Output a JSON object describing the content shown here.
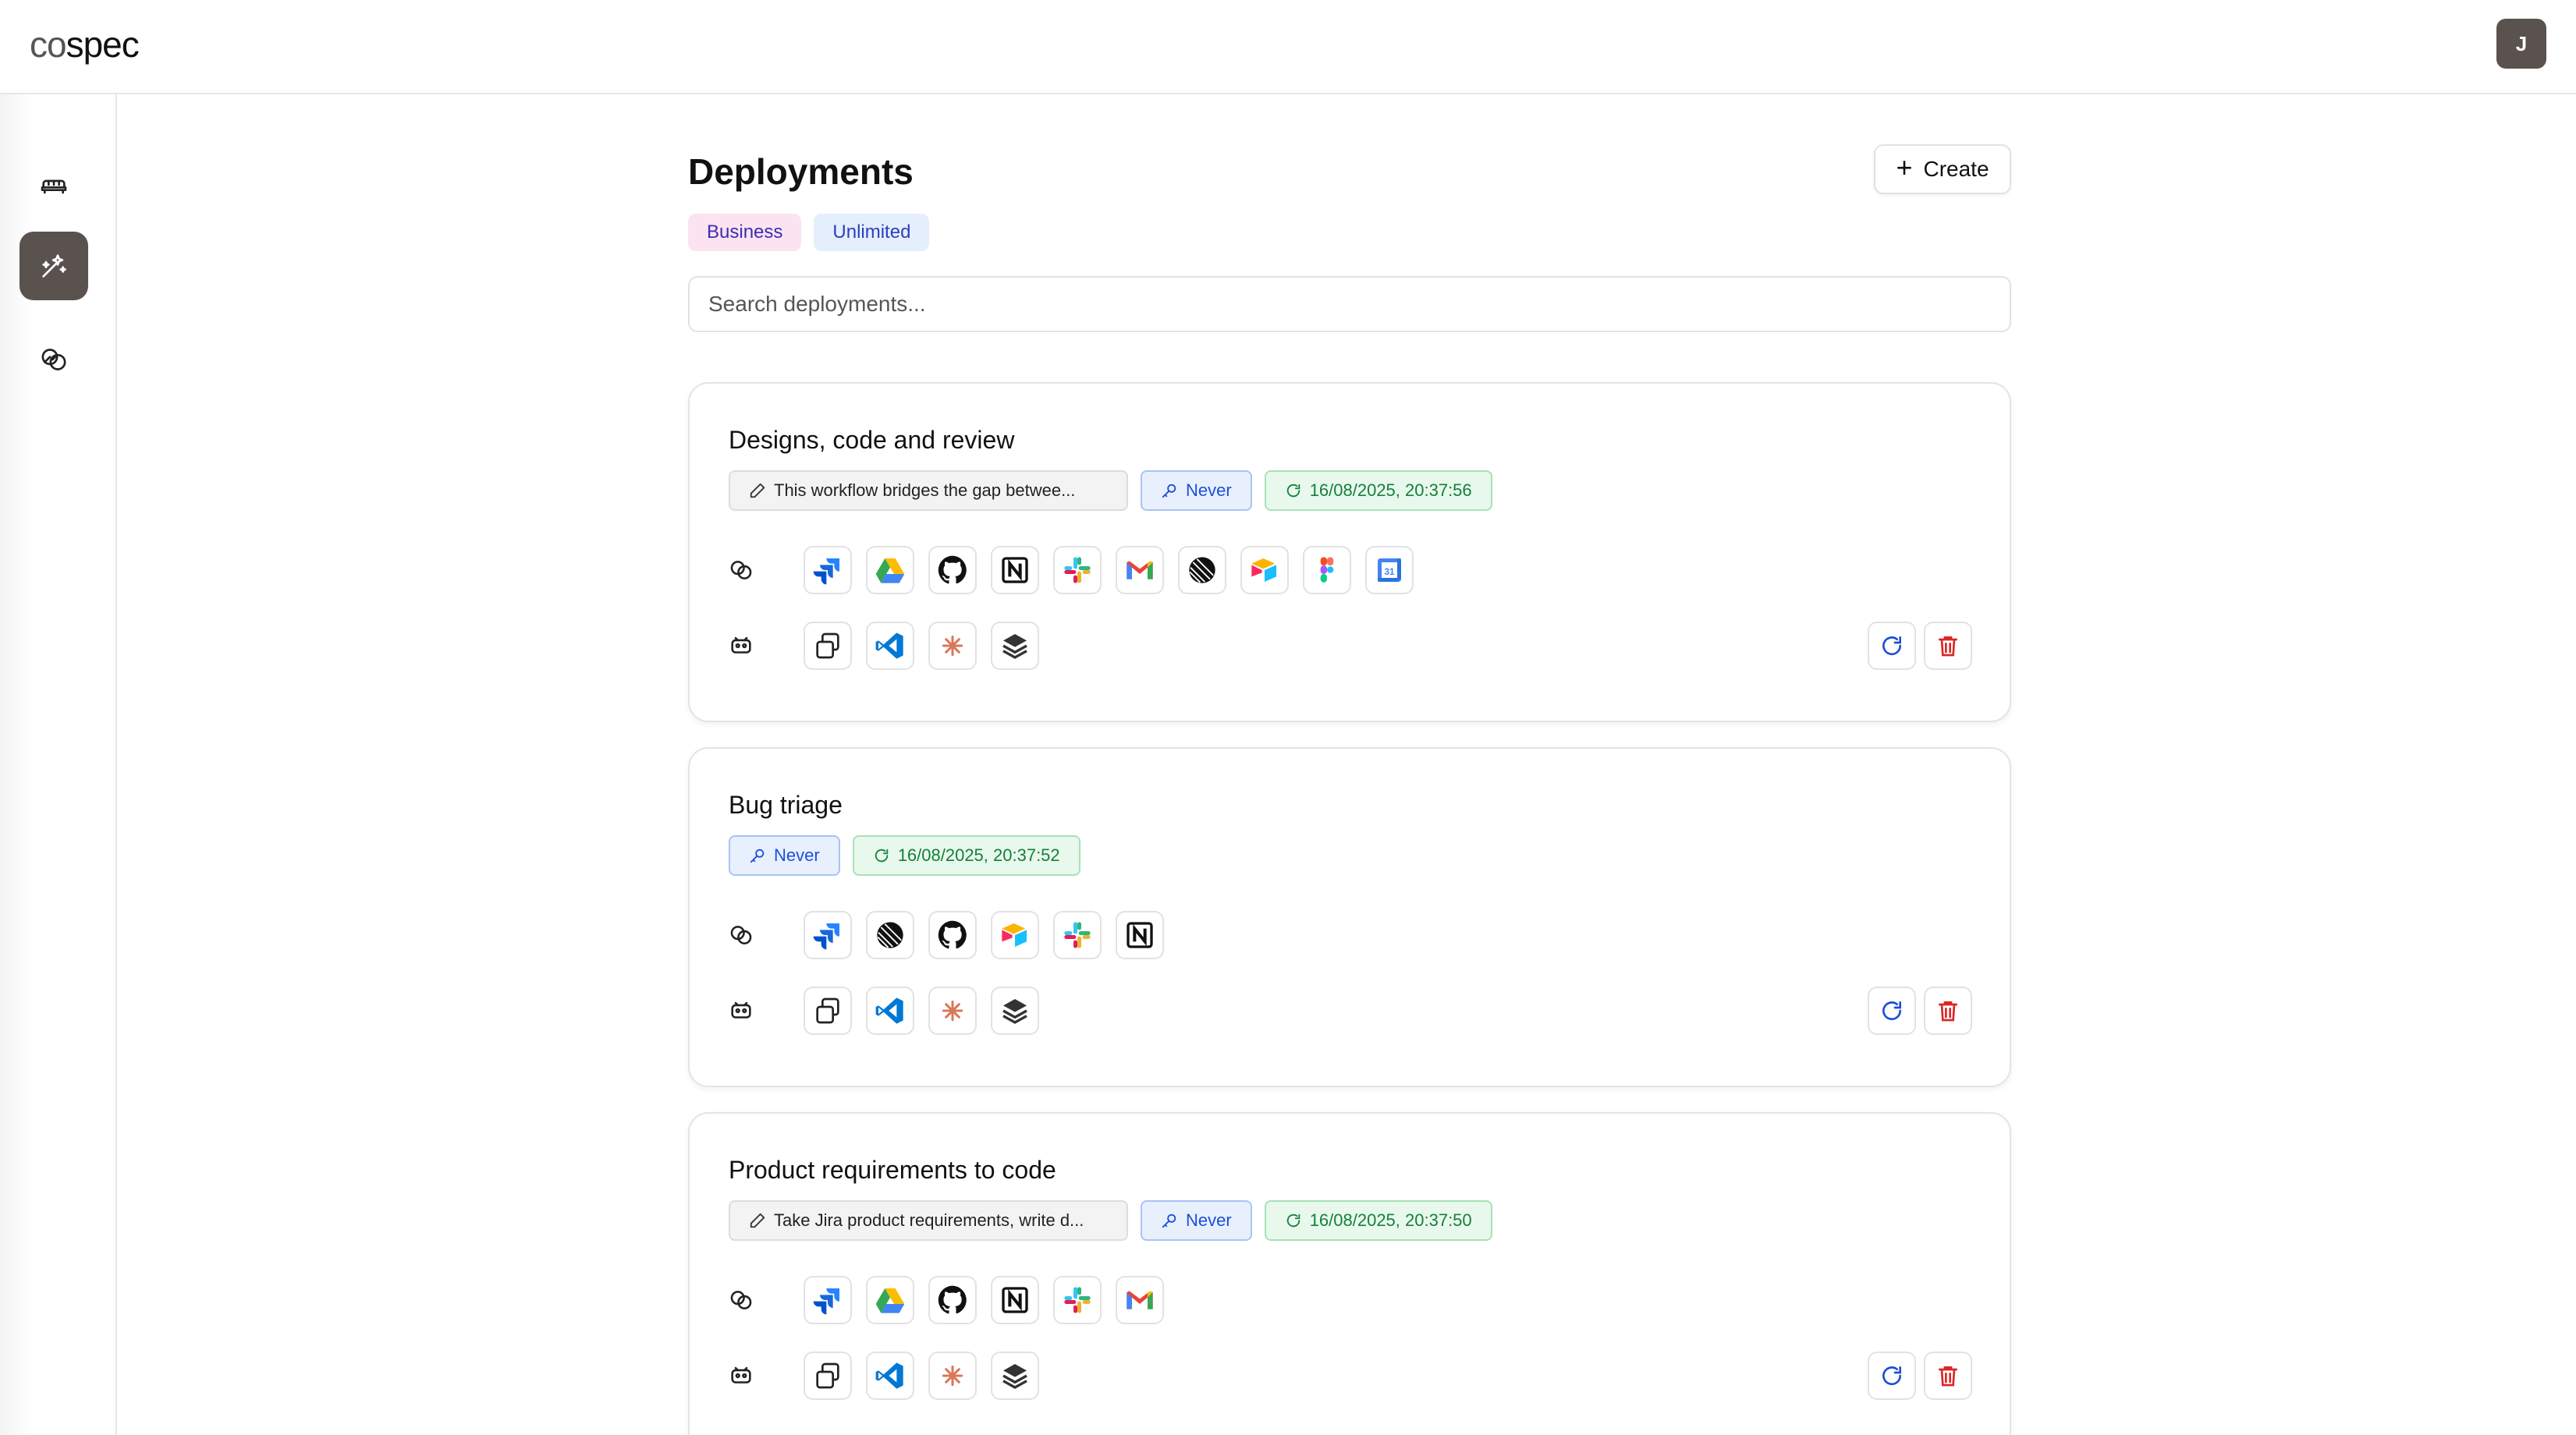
{
  "header": {
    "logo_light": "co",
    "logo_dark": "spec",
    "avatar_initial": "J"
  },
  "sidebar": {
    "items": [
      {
        "icon": "agent-sofa-icon",
        "active": false
      },
      {
        "icon": "magic-wand-icon",
        "active": true
      },
      {
        "icon": "integrations-link-icon",
        "active": false
      }
    ]
  },
  "page": {
    "title": "Deployments",
    "create_label": "Create",
    "plans": [
      "Business",
      "Unlimited"
    ],
    "search_placeholder": "Search deployments..."
  },
  "deployments": [
    {
      "title": "Designs, code and review",
      "description": "This workflow bridges the gap betwee...",
      "schedule": "Never",
      "last_run": "16/08/2025, 20:37:56",
      "integrations": [
        "jira",
        "google-drive",
        "github",
        "notion",
        "slack",
        "gmail",
        "linear",
        "airtable",
        "figma",
        "google-calendar"
      ],
      "agents": [
        "copy",
        "vscode",
        "claude",
        "layers"
      ]
    },
    {
      "title": "Bug triage",
      "description": "",
      "schedule": "Never",
      "last_run": "16/08/2025, 20:37:52",
      "integrations": [
        "jira",
        "linear",
        "github",
        "airtable",
        "slack",
        "notion"
      ],
      "agents": [
        "copy",
        "vscode",
        "claude",
        "layers"
      ]
    },
    {
      "title": "Product requirements to code",
      "description": "Take Jira product requirements, write d...",
      "schedule": "Never",
      "last_run": "16/08/2025, 20:37:50",
      "integrations": [
        "jira",
        "google-drive",
        "github",
        "notion",
        "slack",
        "gmail"
      ],
      "agents": [
        "copy",
        "vscode",
        "claude",
        "layers"
      ]
    }
  ],
  "colors": {
    "accent_dark": "#5a524f",
    "plan_business_bg": "#fbe3f1",
    "plan_unlimited_bg": "#e5eefc",
    "schedule_blue": "#1d4ed8",
    "sync_green": "#15803d",
    "delete_red": "#dc2626"
  }
}
